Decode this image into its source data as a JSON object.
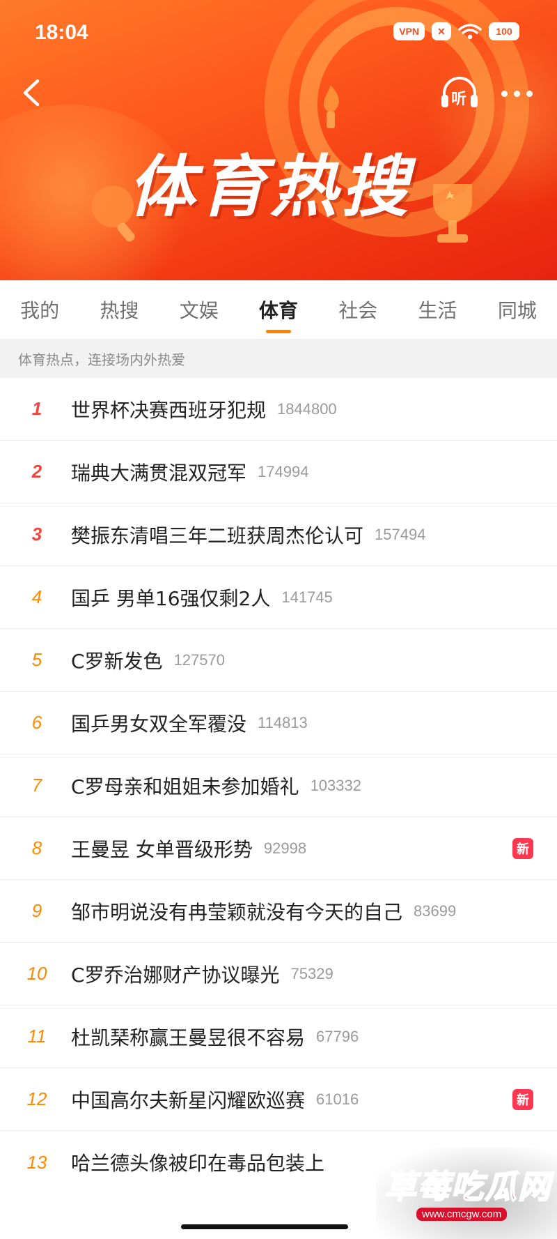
{
  "status_bar": {
    "time": "18:04",
    "vpn_label": "VPN",
    "battery": "100"
  },
  "header": {
    "title": "体育热搜",
    "listen_label": "听"
  },
  "tabs": [
    {
      "label": "我的",
      "active": false
    },
    {
      "label": "热搜",
      "active": false
    },
    {
      "label": "文娱",
      "active": false
    },
    {
      "label": "体育",
      "active": true
    },
    {
      "label": "社会",
      "active": false
    },
    {
      "label": "生活",
      "active": false
    },
    {
      "label": "同城",
      "active": false
    }
  ],
  "subtitle": "体育热点，连接场内外热爱",
  "list": [
    {
      "rank": "1",
      "title": "世界杯决赛西班牙犯规",
      "count": "1844800",
      "badge": ""
    },
    {
      "rank": "2",
      "title": "瑞典大满贯混双冠军",
      "count": "174994",
      "badge": ""
    },
    {
      "rank": "3",
      "title": "樊振东清唱三年二班获周杰伦认可",
      "count": "157494",
      "badge": ""
    },
    {
      "rank": "4",
      "title": "国乒 男单16强仅剩2人",
      "count": "141745",
      "badge": ""
    },
    {
      "rank": "5",
      "title": "C罗新发色",
      "count": "127570",
      "badge": ""
    },
    {
      "rank": "6",
      "title": "国乒男女双全军覆没",
      "count": "114813",
      "badge": ""
    },
    {
      "rank": "7",
      "title": "C罗母亲和姐姐未参加婚礼",
      "count": "103332",
      "badge": ""
    },
    {
      "rank": "8",
      "title": "王曼昱 女单晋级形势",
      "count": "92998",
      "badge": "新"
    },
    {
      "rank": "9",
      "title": "邹市明说没有冉莹颖就没有今天的自己",
      "count": "83699",
      "badge": ""
    },
    {
      "rank": "10",
      "title": "C罗乔治娜财产协议曝光",
      "count": "75329",
      "badge": ""
    },
    {
      "rank": "11",
      "title": "杜凯琹称赢王曼昱很不容易",
      "count": "67796",
      "badge": ""
    },
    {
      "rank": "12",
      "title": "中国高尔夫新星闪耀欧巡赛",
      "count": "61016",
      "badge": "新"
    },
    {
      "rank": "13",
      "title": "哈兰德头像被印在毒品包装上",
      "count": "",
      "badge": ""
    }
  ],
  "watermark": {
    "text": "草莓吃瓜网",
    "url": "www.cmcgw.com"
  },
  "colors": {
    "banner": "#f3521c",
    "tab_underline": "#ff8200",
    "rank_top": "#f2453d",
    "rank_other": "#ff8a00",
    "badge_new": "#ff3852"
  }
}
